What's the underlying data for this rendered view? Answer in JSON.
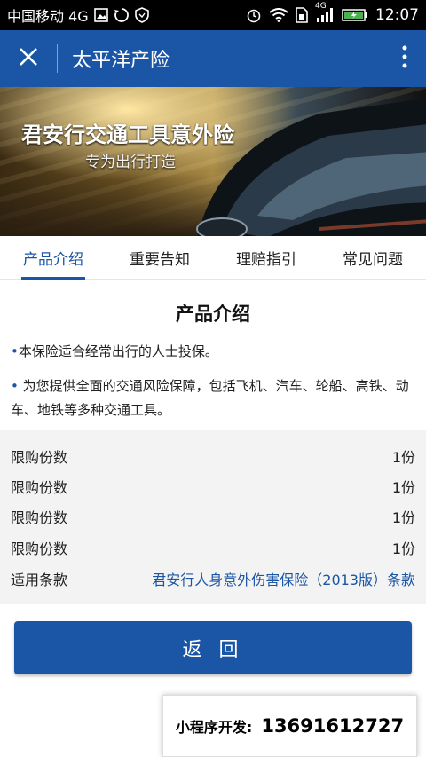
{
  "status_bar": {
    "carrier": "中国移动 4G",
    "time": "12:07",
    "network_label": "4G"
  },
  "app_bar": {
    "title": "太平洋产险"
  },
  "banner": {
    "title": "君安行交通工具意外险",
    "subtitle": "专为出行打造"
  },
  "tabs": [
    {
      "label": "产品介绍",
      "active": true
    },
    {
      "label": "重要告知",
      "active": false
    },
    {
      "label": "理赔指引",
      "active": false
    },
    {
      "label": "常见问题",
      "active": false
    }
  ],
  "content": {
    "section_title": "产品介绍",
    "bullets": [
      "本保险适合经常出行的人士投保。",
      " 为您提供全面的交通风险保障，包括飞机、汽车、轮船、高铁、动车、地铁等多种交通工具。"
    ],
    "rows": [
      {
        "label": "限购份数",
        "value": "1份"
      },
      {
        "label": "限购份数",
        "value": "1份"
      },
      {
        "label": "限购份数",
        "value": "1份"
      },
      {
        "label": "限购份数",
        "value": "1份"
      }
    ],
    "terms_label": "适用条款",
    "terms_link": "君安行人身意外伤害保险（2013版）条款"
  },
  "back_button": "返 回",
  "promo": {
    "label": "小程序开发:",
    "phone": "13691612727"
  },
  "colors": {
    "brand": "#1a55a6",
    "status_bar": "#000000",
    "battery": "#4caf50"
  }
}
